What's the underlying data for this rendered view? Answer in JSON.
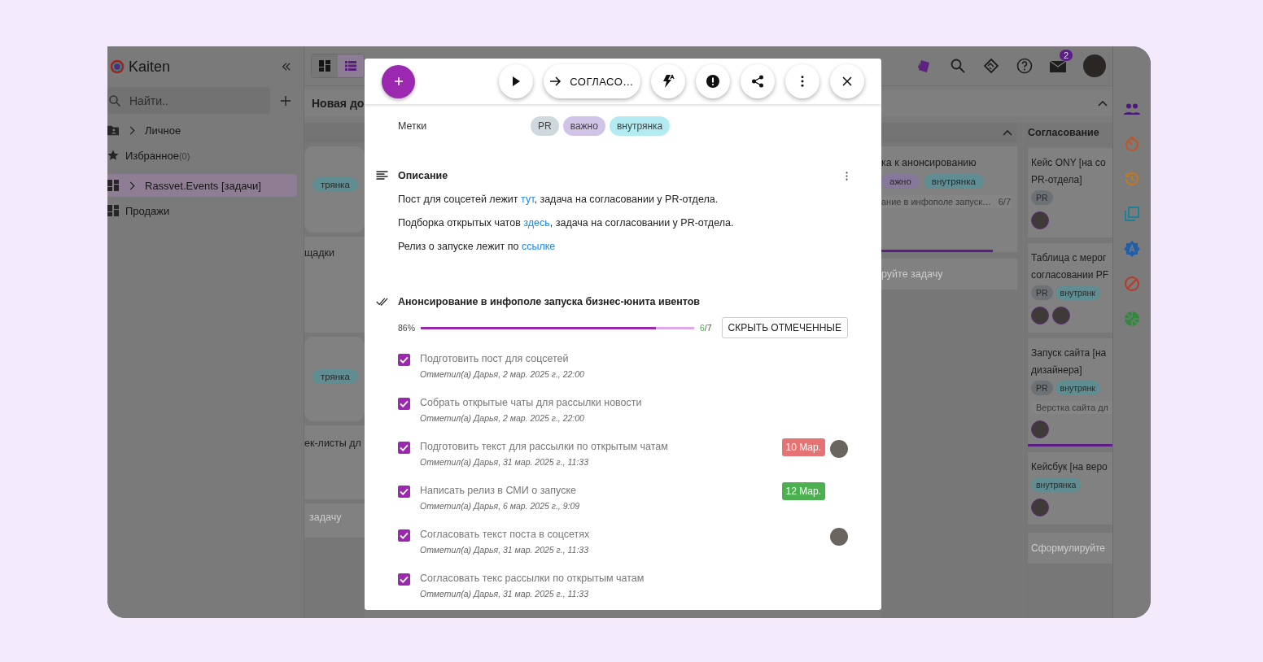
{
  "sidebar": {
    "logo": "Kaiten",
    "search": {
      "placeholder": "Найти.."
    },
    "items": [
      {
        "label": "Личное",
        "expandable": true,
        "selected": false
      },
      {
        "label": "Избранное",
        "count": "(0)",
        "expandable": false,
        "selected": false
      },
      {
        "label": "Rassvet.Events [задачи]",
        "expandable": true,
        "selected": true
      },
      {
        "label": "Продажи",
        "expandable": false,
        "selected": false
      }
    ]
  },
  "topbar": {
    "view_tabs": [
      {
        "selected": false
      },
      {
        "selected": true
      }
    ],
    "notifications": "2"
  },
  "board": {
    "title": "Новая до",
    "left_column": [
      {
        "kind": "tag",
        "text": "трянка",
        "color": "#5f8d92"
      },
      {
        "kind": "title",
        "text": "щадки"
      },
      {
        "kind": "tag",
        "text": "трянка",
        "color": "#5f8d92"
      },
      {
        "kind": "title",
        "text": "ек-листы дл"
      },
      {
        "kind": "placeholder",
        "text": "задачу"
      }
    ],
    "middle_column": {
      "cards": [
        {
          "title_lines": [
            "ка к анонсированию"
          ],
          "tags": [
            {
              "text": "ажно",
              "color": "#86789a"
            },
            {
              "text": "внутрянка",
              "color": "#5f8d92"
            }
          ],
          "checklist": "ание в инфополе запуск…",
          "checklist_count": "6/7",
          "level": 0.86
        }
      ],
      "placeholder": "руйте задачу"
    },
    "right_column": {
      "title": "Согласование",
      "cards": [
        {
          "title_lines": [
            "Кейс ONY [на со",
            "PR-отдела]"
          ],
          "tags": [
            {
              "text": "PR",
              "color": "#6b7174"
            }
          ],
          "assignees": [
            {
              "kind": "photo"
            }
          ]
        },
        {
          "title_lines": [
            "Таблица с мерог",
            "согласовании PF"
          ],
          "tags": [
            {
              "text": "PR",
              "color": "#6b7174"
            },
            {
              "text": "внутрянк",
              "color": "#5f8d92"
            }
          ],
          "assignees": [
            {
              "kind": "photo"
            },
            {
              "kind": "photo"
            }
          ]
        },
        {
          "title_lines": [
            "Запуск сайта [на",
            "дизайнера]"
          ],
          "tags": [
            {
              "text": "PR",
              "color": "#6b7174"
            },
            {
              "text": "внутрянк",
              "color": "#5f8d92"
            }
          ],
          "checklist": "Верстка сайта дл",
          "accent_line": true,
          "assignees": [
            {
              "kind": "photo"
            }
          ]
        },
        {
          "title_lines": [
            "Кейсбук [на веро"
          ],
          "tags": [
            {
              "text": "внутрянка",
              "color": "#5f8d92"
            }
          ],
          "assignees": [
            {
              "kind": "photo"
            }
          ]
        }
      ],
      "placeholder": "Сформулируйте"
    }
  },
  "rail": [
    {
      "color": "#4b1b7a"
    },
    {
      "color": "#c0552a"
    },
    {
      "color": "#c8781c"
    },
    {
      "color": "#1f7f96"
    },
    {
      "color": "#1f5faa"
    },
    {
      "color": "#b83a2a"
    },
    {
      "color": "#2e8a3a"
    }
  ],
  "dialog": {
    "status_button": "СОГЛАСО…",
    "labels": {
      "label": "Метки",
      "tags": [
        {
          "text": "PR",
          "color": "#cfd8dc"
        },
        {
          "text": "важно",
          "color": "#d1c4e9"
        },
        {
          "text": "внутрянка",
          "color": "#b2ebf2"
        }
      ]
    },
    "description": {
      "title": "Описание",
      "paragraphs": [
        {
          "before": "Пост для соцсетей лежит ",
          "link": "тут",
          "after": ", задача на согласовании у PR-отдела."
        },
        {
          "before": "Подборка открытых чатов ",
          "link": "здесь",
          "after": ", задача на согласовании у PR-отдела."
        },
        {
          "before": "Релиз о запуске лежит по ",
          "link": "ссылке"
        }
      ]
    },
    "checklist": {
      "title": "Анонсирование в инфополе запуска бизнес-юнита ивентов",
      "percent": "86%",
      "level": 0.86,
      "done": "6",
      "total": "/7",
      "hide_button": "СКРЫТЬ ОТМЕЧЕННЫЕ",
      "items": [
        {
          "text": "Подготовить пост для соцсетей",
          "note": "Отметил(а) Дарья, 2 мар. 2025 г., 22:00",
          "checked": true,
          "assignee": false
        },
        {
          "text": "Собрать открытые чаты для рассылки новости",
          "note": "Отметил(а) Дарья, 2 мар. 2025 г., 22:00",
          "checked": true,
          "assignee": false
        },
        {
          "text": "Подготовить текст для рассылки по открытым чатам",
          "note": "Отметил(а) Дарья, 31 мар. 2025 г., 11:33",
          "checked": true,
          "due": {
            "text": "10 Мар.",
            "color": "#e57373"
          },
          "assignee": true
        },
        {
          "text": "Написать релиз в СМИ о запуске",
          "note": "Отметил(а) Дарья, 6 мар. 2025 г., 9:09",
          "checked": true,
          "due": {
            "text": "12 Мар.",
            "color": "#4caf50"
          },
          "assignee": false
        },
        {
          "text": "Согласовать текст поста в соцсетях",
          "note": "Отметил(а) Дарья, 31 мар. 2025 г., 11:33",
          "checked": true,
          "assignee": true
        },
        {
          "text": "Согласовать текс рассылки по открытым чатам",
          "note": "Отметил(а) Дарья, 31 мар. 2025 г., 11:33",
          "checked": true,
          "assignee": false
        }
      ]
    }
  }
}
